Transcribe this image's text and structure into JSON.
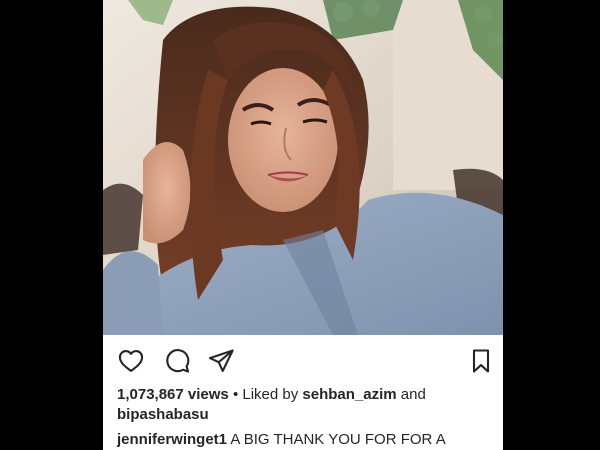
{
  "post": {
    "views_count": "1,073,867 views",
    "liked_by_prefix": "Liked by",
    "liked_by_user": "sehban_azim",
    "and_text": "and",
    "second_liker": "bipashabasu",
    "caption_user": "jenniferwinget1",
    "caption_text": "A BIG THANK YOU FOR FOR A"
  },
  "icons": {
    "like": "heart-icon",
    "comment": "comment-icon",
    "share": "send-icon",
    "save": "bookmark-icon"
  },
  "colors": {
    "text": "#262626",
    "background": "#ffffff",
    "frame": "#000000"
  }
}
